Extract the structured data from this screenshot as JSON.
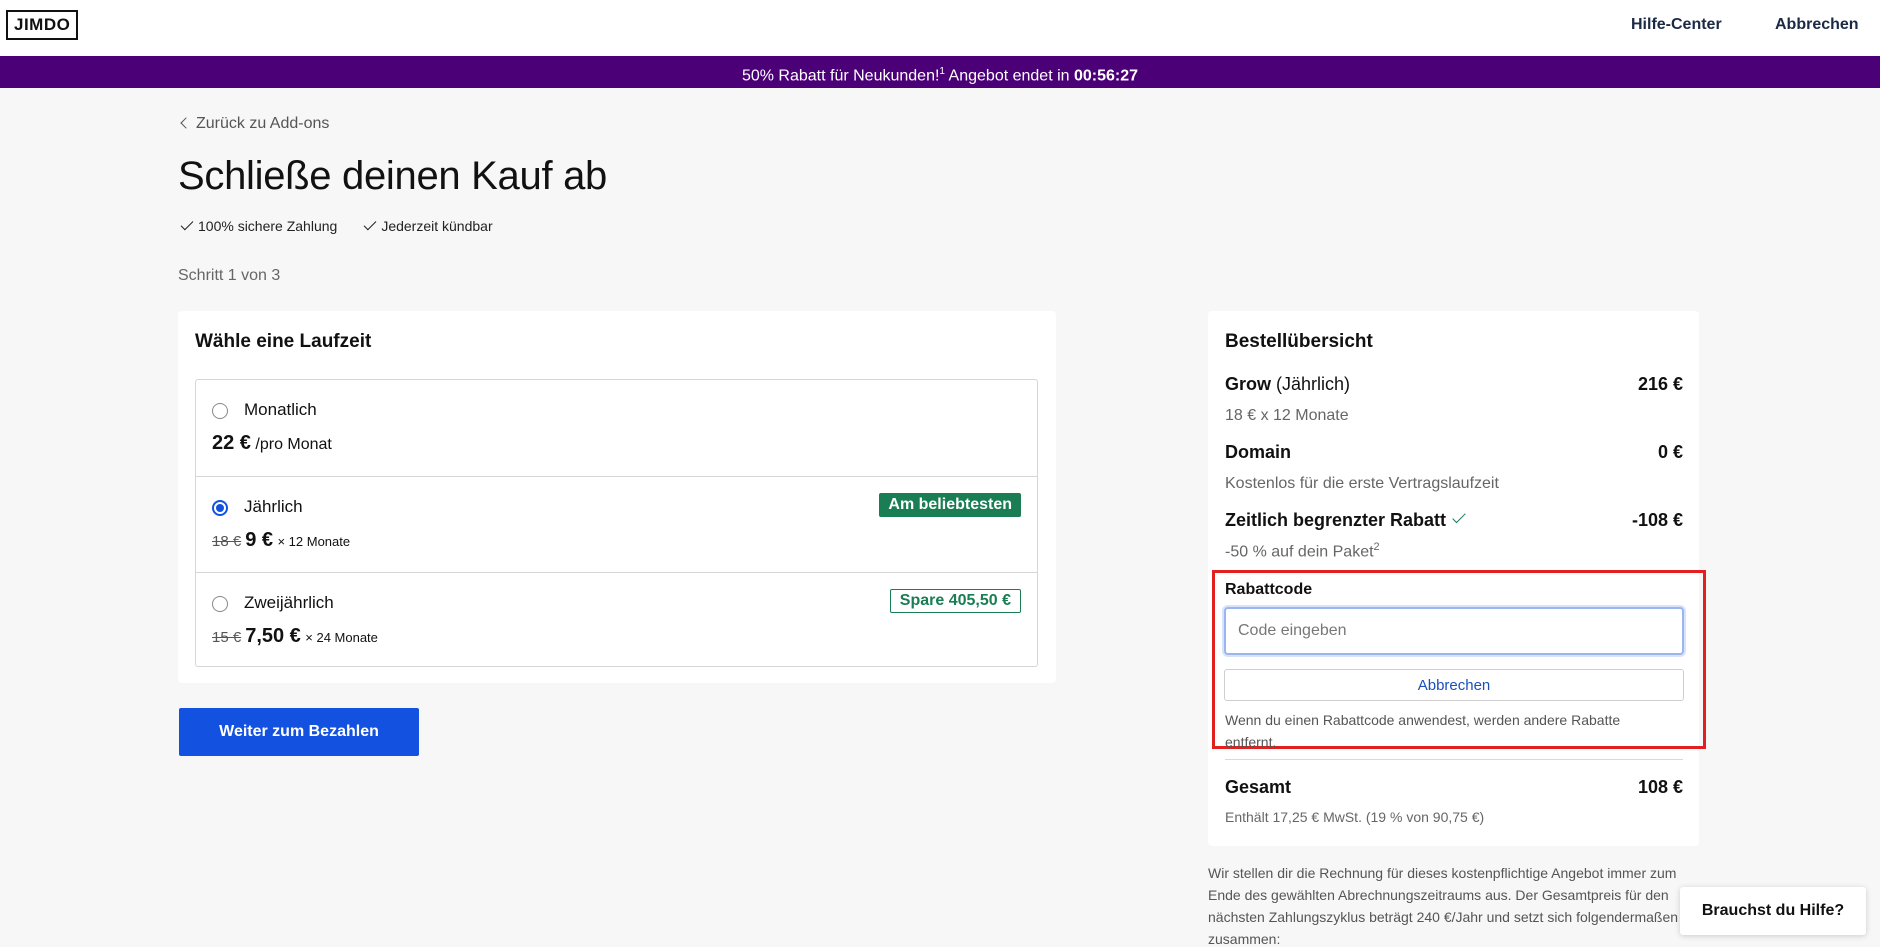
{
  "header": {
    "logo": "JIMDO",
    "help_center": "Hilfe-Center",
    "cancel": "Abbrechen"
  },
  "promo": {
    "text": "50% Rabatt für Neukunden!",
    "sup": "1",
    "offer_ends": "Angebot endet in",
    "countdown": "00:56:27"
  },
  "page": {
    "back": "Zurück zu Add-ons",
    "title": "Schließe deinen Kauf ab",
    "check1": "100% sichere Zahlung",
    "check2": "Jederzeit kündbar",
    "step": "Schritt 1 von 3"
  },
  "plans": {
    "heading": "Wähle eine Laufzeit",
    "options": [
      {
        "label": "Monatlich",
        "price": "22 €",
        "unit": "/pro Monat",
        "selected": false
      },
      {
        "label": "Jährlich",
        "old_price": "18 €",
        "price": "9 €",
        "unit": "× 12 Monate",
        "badge": "Am beliebtesten",
        "selected": true
      },
      {
        "label": "Zweijährlich",
        "old_price": "15 €",
        "price": "7,50 €",
        "unit": "× 24 Monate",
        "badge": "Spare 405,50 €",
        "selected": false
      }
    ],
    "cta": "Weiter zum Bezahlen"
  },
  "summary": {
    "heading": "Bestellübersicht",
    "grow": {
      "name": "Grow",
      "cycle": "(Jährlich)",
      "amount": "216 €",
      "detail": "18 € x 12 Monate"
    },
    "domain": {
      "name": "Domain",
      "amount": "0 €",
      "detail": "Kostenlos für die erste Vertragslaufzeit"
    },
    "discount": {
      "name": "Zeitlich begrenzter Rabatt",
      "amount": "-108 €",
      "detail": "-50 % auf dein Paket",
      "sup": "2"
    },
    "promo_code": {
      "label": "Rabattcode",
      "placeholder": "Code eingeben",
      "cancel": "Abbrechen",
      "note": "Wenn du einen Rabattcode anwendest, werden andere Rabatte entfernt."
    },
    "total": {
      "name": "Gesamt",
      "amount": "108 €",
      "vat": "Enthält 17,25 € MwSt. (19 % von 90,75 €)"
    }
  },
  "legal": "Wir stellen dir die Rechnung für dieses kostenpflichtige Angebot immer zum Ende des gewählten Abrechnungszeitraums aus. Der Gesamtpreis für den nächsten Zahlungszyklus beträgt 240 €/Jahr und setzt sich folgendermaßen zusammen:",
  "help_widget": "Brauchst du Hilfe?",
  "colors": {
    "promo_bar": "#4b0078",
    "primary": "#1352e0",
    "badge_green": "#1a7d54",
    "highlight_red": "#e1201f"
  }
}
